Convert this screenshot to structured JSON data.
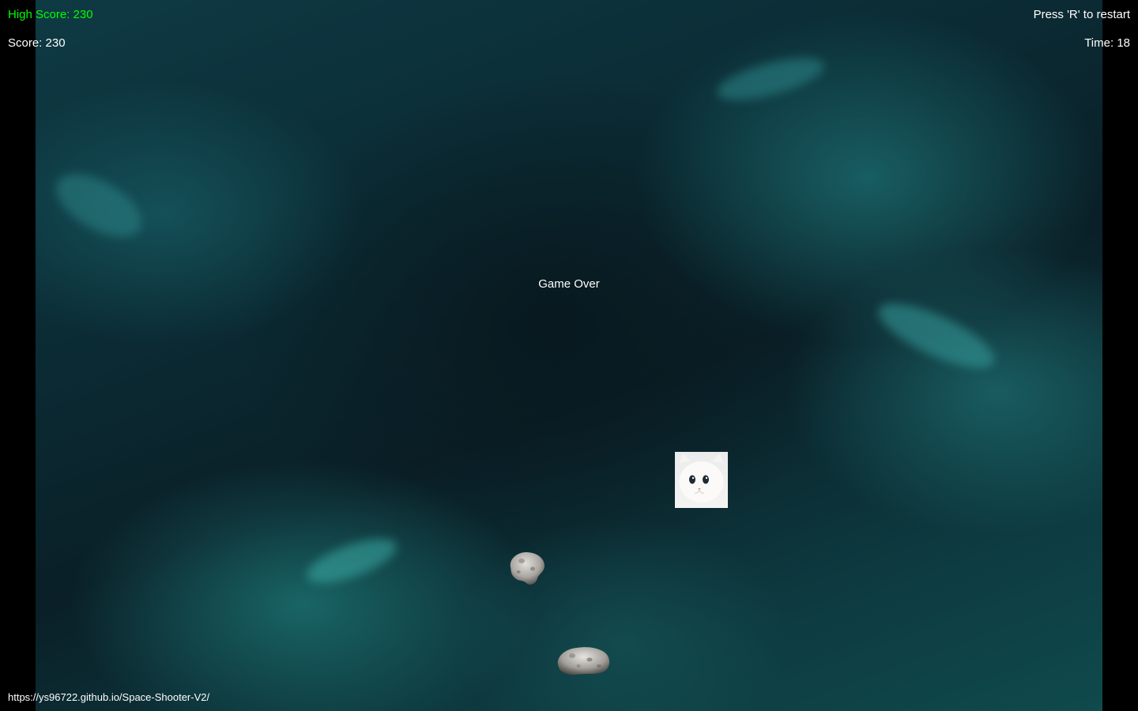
{
  "hud": {
    "high_score": "High Score: 230",
    "score": "Score: 230",
    "restart_hint": "Press 'R' to restart",
    "time": "Time: 18"
  },
  "status": {
    "message": "Game Over"
  },
  "footer": {
    "url": "https://ys96722.github.io/Space-Shooter-V2/"
  },
  "sprites": {
    "player": "cat-face-icon",
    "enemies": [
      "asteroid-icon",
      "asteroid-icon"
    ]
  },
  "colors": {
    "high_score": "#00ff00",
    "text": "#ffffff",
    "letterbox": "#000000",
    "nebula_accent": "#2a9a9a"
  }
}
